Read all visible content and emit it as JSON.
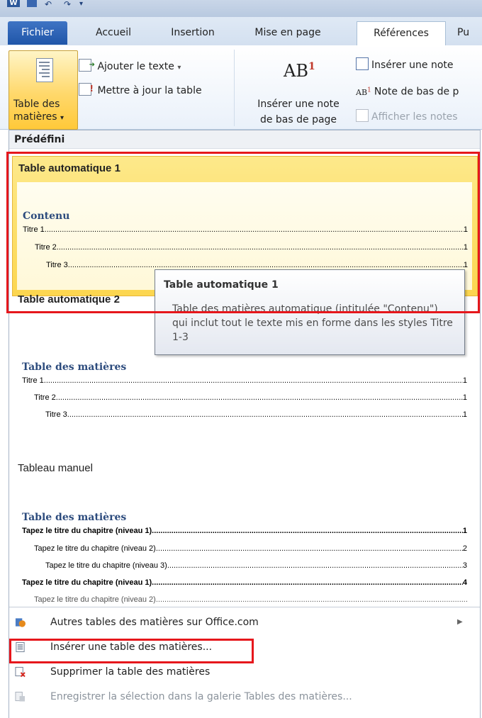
{
  "quick_access": {
    "app_icon": "W",
    "icons": [
      "word-icon",
      "save-icon",
      "undo-icon",
      "redo-icon",
      "qat-dropdown-icon"
    ]
  },
  "tabs": {
    "file": "Fichier",
    "home": "Accueil",
    "insert": "Insertion",
    "layout": "Mise en page",
    "references": "Références",
    "more": "Pu"
  },
  "ribbon": {
    "toc_button_line1": "Table des",
    "toc_button_line2": "matières",
    "add_text": "Ajouter le texte",
    "update_table": "Mettre à jour la table",
    "footnote_icon_text": "AB",
    "footnote_icon_sup": "1",
    "insert_footnote_line1": "Insérer une note",
    "insert_footnote_line2": "de bas de page",
    "insert_endnote": "Insérer une note",
    "next_footnote": "Note de bas de p",
    "show_notes": "Afficher les notes"
  },
  "gallery": {
    "section_header": "Prédéfini",
    "auto1": {
      "title": "Table automatique 1",
      "heading": "Contenu",
      "lines": [
        {
          "text": "Titre 1",
          "page": "1"
        },
        {
          "text": "Titre 2",
          "page": "1"
        },
        {
          "text": "Titre 3",
          "page": "1"
        }
      ]
    },
    "auto2": {
      "title": "Table automatique 2",
      "heading": "Table des matières",
      "lines": [
        {
          "text": "Titre 1",
          "page": "1"
        },
        {
          "text": "Titre 2",
          "page": "1"
        },
        {
          "text": "Titre 3",
          "page": "1"
        }
      ]
    },
    "manual": {
      "title": "Tableau manuel",
      "heading": "Table des matières",
      "lines": [
        {
          "text": "Tapez le titre du chapitre (niveau 1)",
          "page": "1"
        },
        {
          "text": "Tapez le titre du chapitre (niveau 2)",
          "page": "2"
        },
        {
          "text": "Tapez le titre du chapitre (niveau 3)",
          "page": "3"
        },
        {
          "text": "Tapez le titre du chapitre (niveau 1)",
          "page": "4"
        }
      ]
    }
  },
  "tooltip": {
    "title": "Table automatique 1",
    "body": "Table des matières automatique (intitulée \"Contenu\") qui inclut tout le texte mis en forme dans les styles Titre 1-3"
  },
  "menu": {
    "more_tables": "Autres tables des matières sur Office.com",
    "insert_table": "Insérer une table des matières...",
    "remove_table": "Supprimer la table des matières",
    "save_selection": "Enregistrer la sélection dans la galerie Tables des matières..."
  },
  "colors": {
    "file_tab": "#2b5fb0",
    "highlight_outline": "#e6171c",
    "gallery_hover": "#fcd64f",
    "toc_heading": "#2c4b7d"
  }
}
